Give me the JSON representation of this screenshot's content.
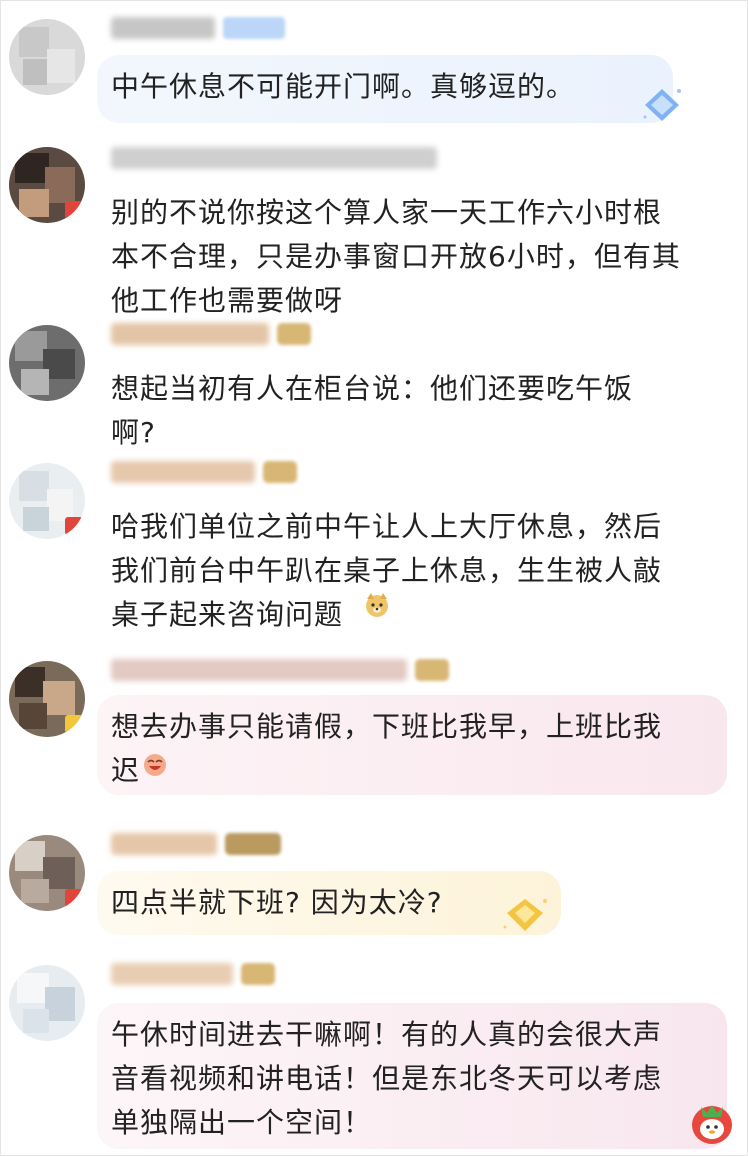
{
  "comments": [
    {
      "text": "中午休息不可能开门啊。真够逗的。"
    },
    {
      "text": "别的不说你按这个算人家一天工作六小时根\n本不合理，只是办事窗口开放6小时，但有其\n他工作也需要做呀"
    },
    {
      "text": "想起当初有人在柜台说：他们还要吃午饭\n啊?"
    },
    {
      "text": "哈我们单位之前中午让人上大厅休息，然后\n我们前台中午趴在桌子上休息，生生被人敲\n桌子起来咨询问题"
    },
    {
      "text": "想去办事只能请假，下班比我早，上班比我\n迟"
    },
    {
      "text": "四点半就下班? 因为太冷?"
    },
    {
      "text": "午休时间进去干嘛啊！有的人真的会很大声\n音看视频和讲电话！但是东北冬天可以考虑\n单独隔出一个空间！"
    }
  ],
  "icons": {
    "avatar": "blurred-avatar",
    "badge": "member-badge-icon",
    "gem": "diamond-gem-icon",
    "emoji_doge": "doge-emoji-icon",
    "emoji_laugh": "laugh-emoji-icon",
    "mascot": "strawberry-mascot-icon"
  },
  "colors": {
    "bubble_blue": "#eaf2fd",
    "bubble_pink": "#fbeff3",
    "bubble_yellow": "#fdf6df",
    "text": "#222222"
  }
}
